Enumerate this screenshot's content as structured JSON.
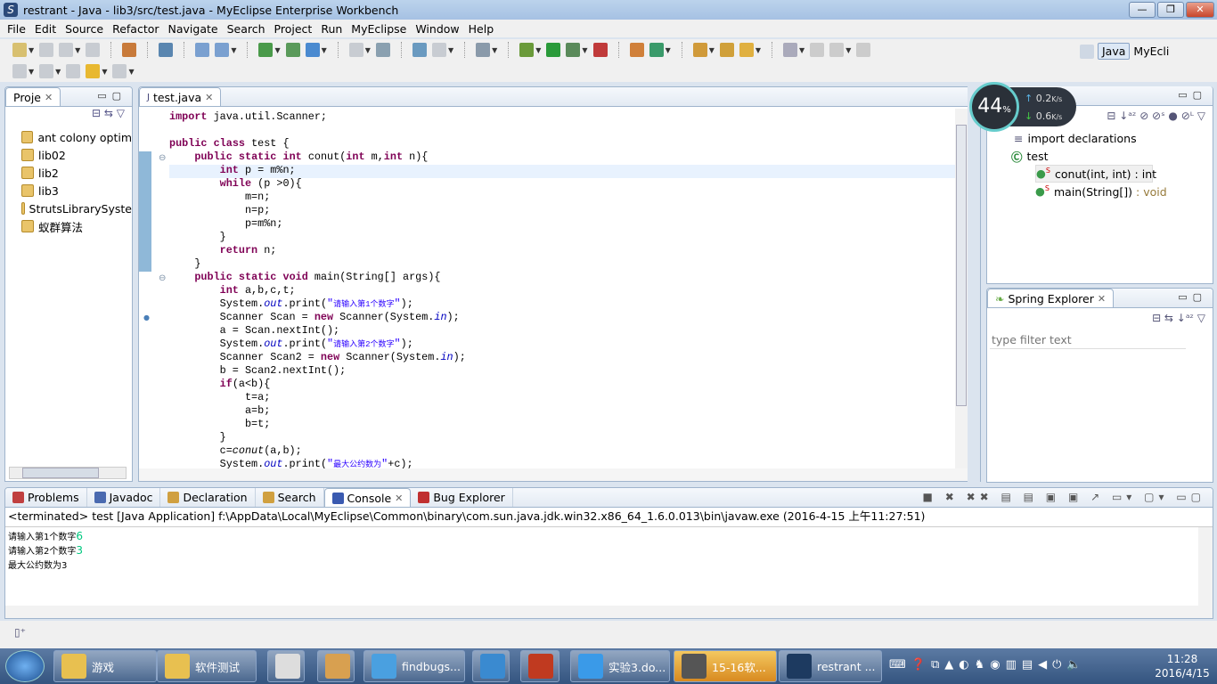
{
  "window": {
    "title": "restrant - Java - lib3/src/test.java - MyEclipse Enterprise Workbench",
    "min": "—",
    "max": "❐",
    "close": "✕"
  },
  "menu": [
    "File",
    "Edit",
    "Source",
    "Refactor",
    "Navigate",
    "Search",
    "Project",
    "Run",
    "MyEclipse",
    "Window",
    "Help"
  ],
  "perspectives": {
    "java": "Java",
    "myeclipse": "MyEcli"
  },
  "package_explorer": {
    "tab": "Proje",
    "items": [
      "ant colony optim",
      "lib02",
      "lib2",
      "lib3",
      "StrutsLibrarySyste",
      "蚁群算法"
    ]
  },
  "editor": {
    "tab": "test.java",
    "lines": [
      "import java.util.Scanner;",
      "",
      "public class test {",
      "    public static int conut(int m,int n){",
      "        int p = m%n;",
      "        while (p >0){",
      "            m=n;",
      "            n=p;",
      "            p=m%n;",
      "        }",
      "        return n;",
      "    }",
      "    public static void main(String[] args){",
      "        int a,b,c,t;",
      "        System.out.print(\"请输入第1个数字\");",
      "        Scanner Scan = new Scanner(System.in);",
      "        a = Scan.nextInt();",
      "        System.out.print(\"请输入第2个数字\");",
      "        Scanner Scan2 = new Scanner(System.in);",
      "        b = Scan2.nextInt();",
      "        if(a<b){",
      "            t=a;",
      "            a=b;",
      "            b=t;",
      "        }",
      "        c=conut(a,b);",
      "        System.out.print(\"最大公约数为\"+c);"
    ]
  },
  "net_widget": {
    "percent": "44",
    "percent_sign": "%",
    "up": "0.2",
    "down": "0.6",
    "unit": "K/s"
  },
  "outline": {
    "items": [
      {
        "label": "import declarations"
      },
      {
        "label": "test"
      },
      {
        "label": "conut(int, int) : int"
      },
      {
        "label": "main(String[])",
        "type": " : void"
      }
    ]
  },
  "spring_explorer": {
    "tab": "Spring Explorer",
    "filter_placeholder": "type filter text"
  },
  "bottom_tabs": [
    "Problems",
    "Javadoc",
    "Declaration",
    "Search",
    "Console",
    "Bug Explorer"
  ],
  "console": {
    "header": "<terminated> test [Java Application] f:\\AppData\\Local\\MyEclipse\\Common\\binary\\com.sun.java.jdk.win32.x86_64_1.6.0.013\\bin\\javaw.exe (2016-4-15 上午11:27:51)",
    "lines": [
      {
        "prompt": "请输入第1个数字",
        "input": "6"
      },
      {
        "prompt": "请输入第2个数字",
        "input": "3"
      },
      {
        "prompt": "最大公约数为3",
        "input": ""
      }
    ]
  },
  "taskbar": {
    "items": [
      "游戏",
      "软件测试",
      "findbugs...",
      "实验3.do...",
      "15-16软...",
      "restrant ..."
    ],
    "time": "11:28",
    "date": "2016/4/15"
  },
  "colors": {
    "accent": "#3875d7",
    "keyword": "#7f0055",
    "string": "#2a00ff",
    "console_input": "#00c87f"
  }
}
